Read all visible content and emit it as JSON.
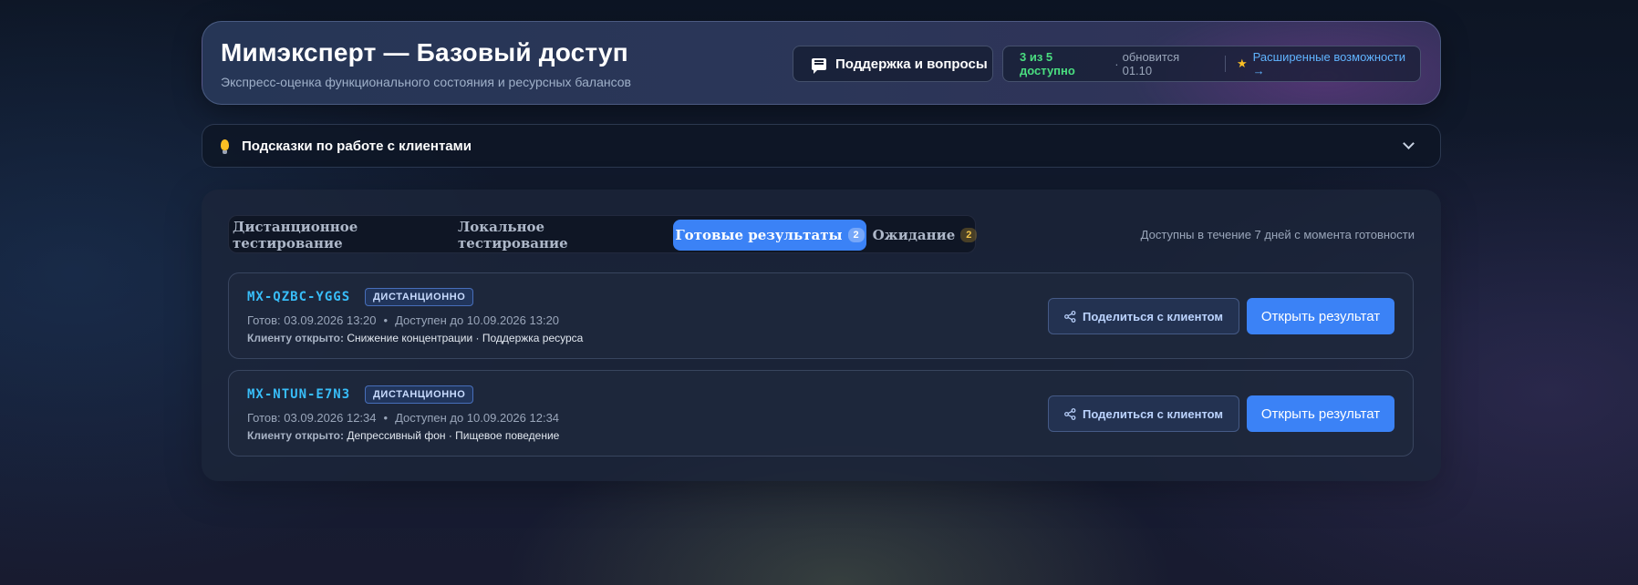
{
  "header": {
    "title": "Мимэксперт — Базовый доступ",
    "subtitle": "Экспресс-оценка функционального состояния и ресурсных балансов",
    "support_label": "Поддержка и вопросы",
    "quota_count": "3 из 5 доступно",
    "quota_separator": "·",
    "quota_update": "обновится 01.10",
    "upgrade_label": "Расширенные возможности →",
    "upgrade_icon": "star-icon"
  },
  "tips": {
    "label": "Подсказки по работе с клиентами",
    "icon": "lightbulb-icon"
  },
  "tabs": [
    {
      "label": "Дистанционное тестирование",
      "badge": null,
      "active": false
    },
    {
      "label": "Локальное тестирование",
      "badge": null,
      "active": false
    },
    {
      "label": "Готовые результаты",
      "badge": "2",
      "active": true
    },
    {
      "label": "Ожидание",
      "badge": "2",
      "active": false
    }
  ],
  "panel_note": "Доступны в течение 7 дней с момента готовности",
  "results": [
    {
      "id": "MX-QZBC-YGGS",
      "tag": "ДИСТАНЦИОННО",
      "ready": "Готов: 03.09.2026 13:20",
      "available": "Доступен до 10.09.2026 13:20",
      "open_label": "Клиенту открыто:",
      "open_items": "Снижение концентрации · Поддержка ресурса",
      "share_label": "Поделиться с клиентом",
      "open_button": "Открыть результат"
    },
    {
      "id": "MX-NTUN-E7N3",
      "tag": "ДИСТАНЦИОННО",
      "ready": "Готов: 03.09.2026 12:34",
      "available": "Доступен до 10.09.2026 12:34",
      "open_label": "Клиенту открыто:",
      "open_items": "Депрессивный фон · Пищевое поведение",
      "share_label": "Поделиться с клиентом",
      "open_button": "Открыть результат"
    }
  ],
  "colors": {
    "accent": "#3b82f6",
    "quota_ok": "#4ade80",
    "link": "#60b4ff",
    "result_id": "#38bdf8",
    "warn_badge": "#f3c54a"
  }
}
